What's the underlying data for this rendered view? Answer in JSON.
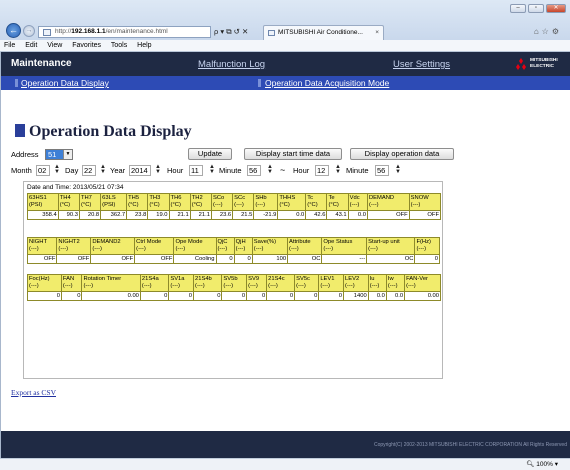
{
  "browser": {
    "url_prefix": "http://",
    "url_host": "192.168.1.1",
    "url_path": "/en/maintenance.html",
    "address_tools": "ρ ▾ ⧉ ↺ ✕",
    "tab_title": "MITSUBISHI Air Conditione...",
    "tab_close": "×",
    "menu": [
      "File",
      "Edit",
      "View",
      "Favorites",
      "Tools",
      "Help"
    ],
    "zoom": "100%",
    "icons": [
      "back-icon",
      "forward-icon",
      "home-icon",
      "star-icon",
      "gear-icon"
    ]
  },
  "header": {
    "title": "Maintenance",
    "link_malfunction": "Malfunction Log",
    "link_user": "User Settings",
    "logo_text_1": "MITSUBISHI",
    "logo_text_2": "ELECTRIC"
  },
  "subnav": {
    "item1": "Operation Data Display",
    "item2": "Operation Data Acquisition Mode"
  },
  "page": {
    "title": "Operation Data Display"
  },
  "controls": {
    "address_label": "Address",
    "address_value": "51",
    "update_button": "Update",
    "start_time_button": "Display start time data",
    "operation_button": "Display operation data",
    "month_label": "Month",
    "month_value": "02",
    "day_label": "Day",
    "day_value": "22",
    "year_label": "Year",
    "year_value": "2014",
    "hour_label": "Hour",
    "hour_value": "11",
    "minute_label": "Minute",
    "minute_value": "56",
    "tilde": "~",
    "hour2_label": "Hour",
    "hour2_value": "12",
    "minute2_label": "Minute",
    "minute2_value": "56"
  },
  "data": {
    "date_time": "Date and Time: 2013/05/21 07:34",
    "table1": {
      "headers": [
        [
          "63HS1",
          "(PSI)"
        ],
        [
          "TH4",
          "(°C)"
        ],
        [
          "TH7",
          "(°C)"
        ],
        [
          "63LS",
          "(PSI)"
        ],
        [
          "TH5",
          "(°C)"
        ],
        [
          "TH3",
          "(°C)"
        ],
        [
          "TH6",
          "(°C)"
        ],
        [
          "TH2",
          "(°C)"
        ],
        [
          "SCo",
          "(---)"
        ],
        [
          "SCc",
          "(---)"
        ],
        [
          "SHb",
          "(---)"
        ],
        [
          "THHS",
          "(°C)"
        ],
        [
          "Tc",
          "(°C)"
        ],
        [
          "Te",
          "(°C)"
        ],
        [
          "Vdc",
          "(---)"
        ],
        [
          "DEMAND",
          "(---)"
        ],
        [
          "SNOW",
          "(---)"
        ]
      ],
      "values": [
        "358.4",
        "90.3",
        "20.8",
        "362.7",
        "23.8",
        "19.0",
        "21.1",
        "21.1",
        "23.6",
        "21.5",
        "-21.9",
        "0.0",
        "42.6",
        "43.1",
        "0.0",
        "OFF",
        "OFF"
      ]
    },
    "table2": {
      "headers": [
        [
          "NIGHT",
          "(---)"
        ],
        [
          "NIGHT2",
          "(---)"
        ],
        [
          "DEMAND2",
          "(---)"
        ],
        [
          "Ctrl Mode",
          "(---)"
        ],
        [
          "Ope Mode",
          "(---)"
        ],
        [
          "QjC",
          "(---)"
        ],
        [
          "QjH",
          "(---)"
        ],
        [
          "Save(%)",
          "(---)"
        ],
        [
          "Attribute",
          "(---)"
        ],
        [
          "Ope Status",
          "(---)"
        ],
        [
          "Start-up unit",
          "(---)"
        ],
        [
          "F(Hz)",
          "(---)"
        ]
      ],
      "values": [
        "OFF",
        "OFF",
        "OFF",
        "OFF",
        "Cooling",
        "0",
        "0",
        "100",
        "OC",
        "---",
        "OC",
        "0"
      ]
    },
    "table3": {
      "headers": [
        [
          "Foc(Hz)",
          "(---)"
        ],
        [
          "FAN",
          "(---)"
        ],
        [
          "Rotation Timer",
          "(---)"
        ],
        [
          "21S4a",
          "(---)"
        ],
        [
          "SV1a",
          "(---)"
        ],
        [
          "21S4b",
          "(---)"
        ],
        [
          "SV5b",
          "(---)"
        ],
        [
          "SV9",
          "(---)"
        ],
        [
          "21S4c",
          "(---)"
        ],
        [
          "SV5c",
          "(---)"
        ],
        [
          "LEV1",
          "(---)"
        ],
        [
          "LEV2",
          "(---)"
        ],
        [
          "Iu",
          "(---)"
        ],
        [
          "Iw",
          "(---)"
        ],
        [
          "FAN-Ver",
          "(---)"
        ]
      ],
      "values": [
        "0",
        "0",
        "0.00",
        "0",
        "0",
        "0",
        "0",
        "0",
        "0",
        "0",
        "0",
        "1400",
        "0.0",
        "0.0",
        "0.00"
      ]
    }
  },
  "export_link": "Export as CSV",
  "footer": {
    "copyright": "Copyright(C) 2002-2013 MITSUBISHI ELECTRIC CORPORATION All Rights Reserved"
  },
  "colors": {
    "header_bg": "#1f2a44",
    "subnav_bg": "#2d4bb5",
    "table_header_bg": "#f1ec6c",
    "link_color": "#2030a0"
  }
}
